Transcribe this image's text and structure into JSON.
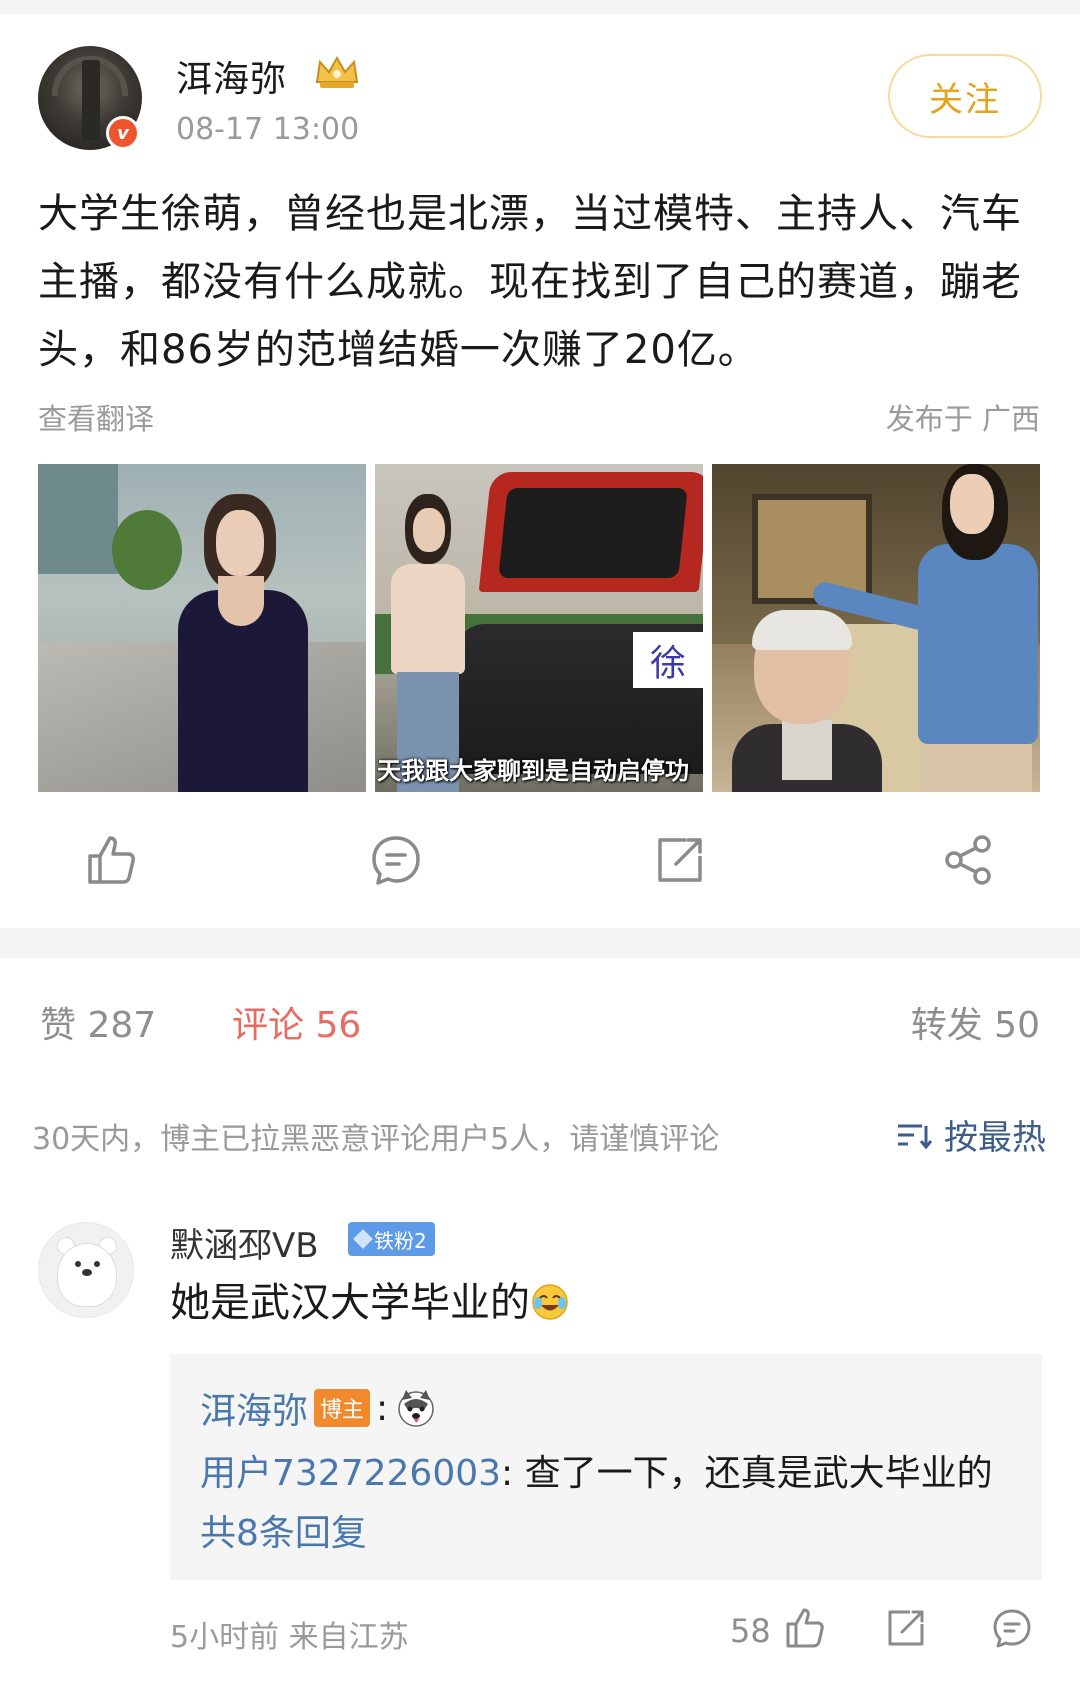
{
  "post": {
    "author": "洱海弥",
    "time": "08-17 13:00",
    "follow_label": "关注",
    "text": "大学生徐萌，曾经也是北漂，当过模特、主持人、汽车主播，都没有什么成就。现在找到了自己的赛道，蹦老头，和86岁的范增结婚一次赚了20亿。",
    "translate_label": "查看翻译",
    "location": "发布于 广西",
    "photo_overlay_badge": "徐",
    "photo_overlay_subtitle": "天我跟大家聊到是自动启停功"
  },
  "actions": {
    "like_icon": "thumbs-up-icon",
    "comment_icon": "comment-icon",
    "repost_icon": "repost-icon",
    "share_icon": "share-icon"
  },
  "tabs": {
    "likes": "赞 287",
    "comments": "评论 56",
    "reposts": "转发 50"
  },
  "comments_header": {
    "notice": "30天内，博主已拉黑恶意评论用户5人，请谨慎评论",
    "sort_label": "按最热"
  },
  "comment": {
    "name": "默涵邳VB",
    "fan_badge": "铁粉2",
    "text": "她是武汉大学毕业的",
    "reply": {
      "author": "洱海弥",
      "author_badge": "博主",
      "colon": ":",
      "user": "用户7327226003",
      "text": ": 查了一下，还真是武大毕业的",
      "more": "共8条回复"
    },
    "meta": "5小时前  来自江苏",
    "likes": "58"
  },
  "colors": {
    "accent_comment": "#e86c62",
    "link": "#4a78ad",
    "follow": "#e8a21a",
    "fan_badge": "#5d9be8",
    "host_badge": "#f08a2c"
  }
}
